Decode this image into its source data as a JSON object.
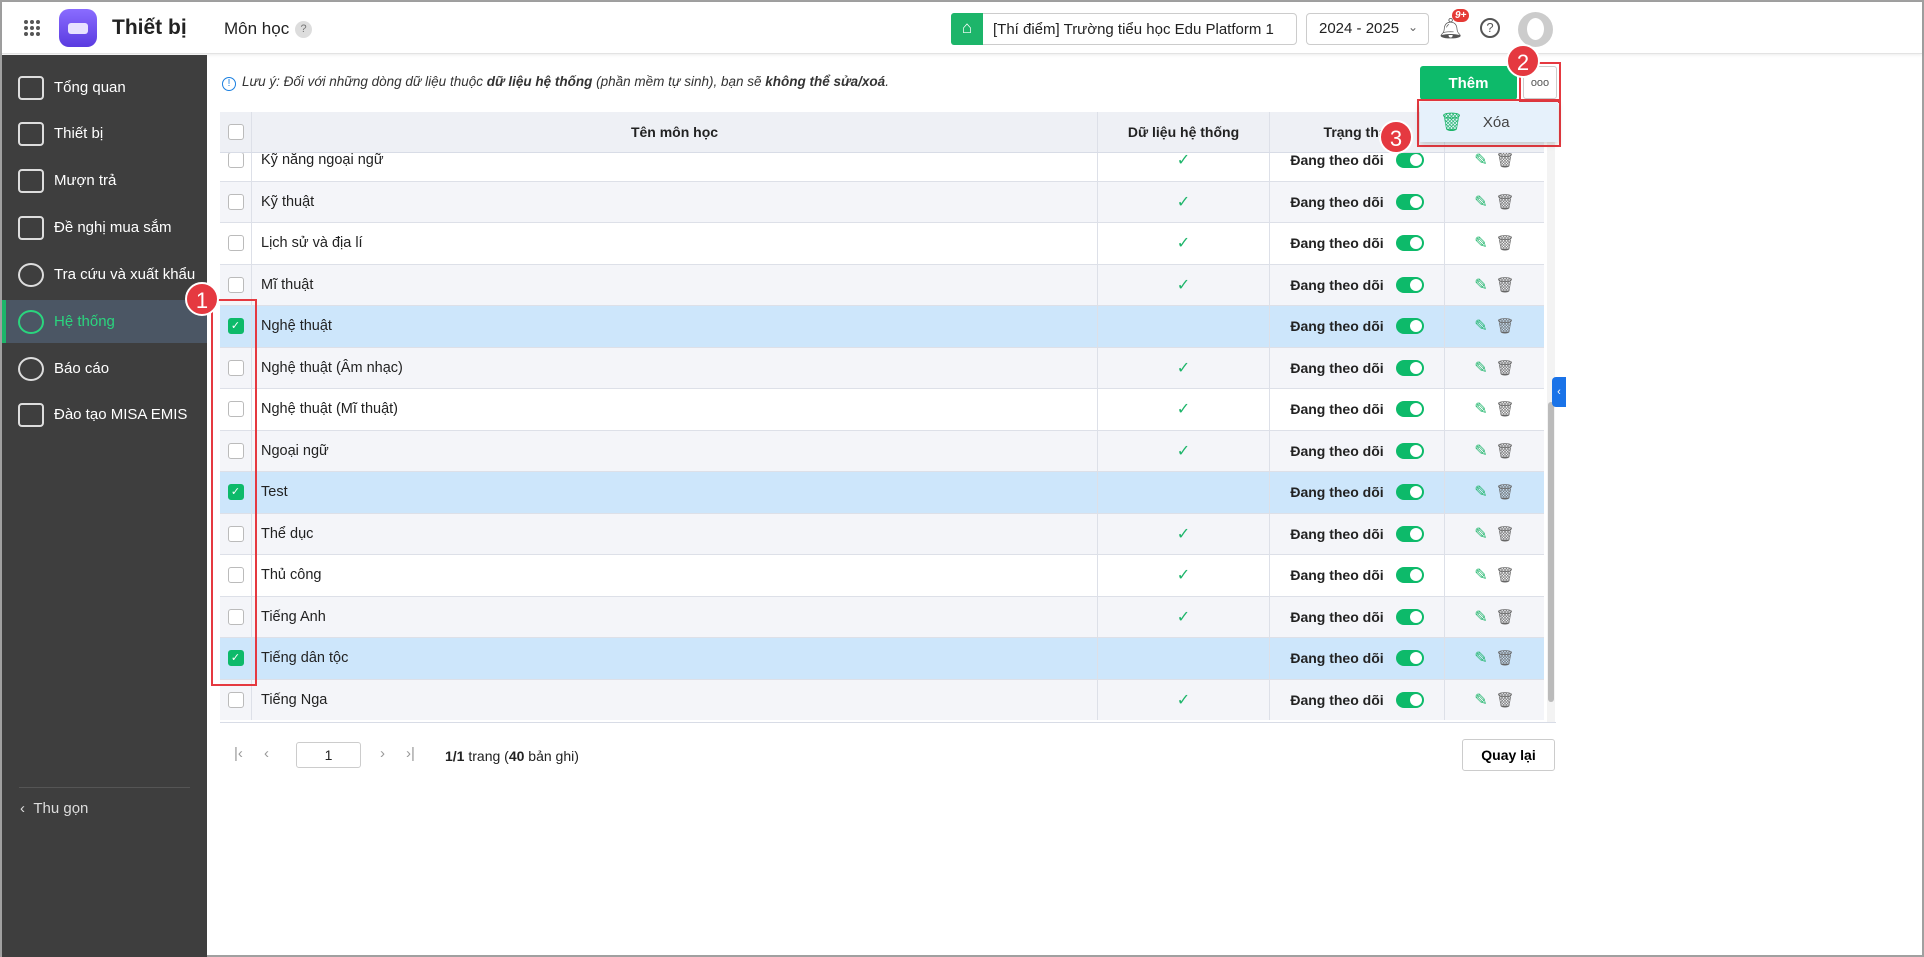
{
  "header": {
    "app_title": "Thiết bị",
    "page_title": "Môn học",
    "help_mark": "?",
    "school": "[Thí điểm] Trường tiểu học Edu Platform 1",
    "year": "2024 - 2025",
    "notif_badge": "9+",
    "help_icon": "?"
  },
  "sidebar": {
    "items": [
      {
        "label": "Tổng quan"
      },
      {
        "label": "Thiết bị"
      },
      {
        "label": "Mượn trả"
      },
      {
        "label": "Đề nghị mua sắm"
      },
      {
        "label": "Tra cứu và xuất khẩu"
      },
      {
        "label": "Hệ thống"
      },
      {
        "label": "Báo cáo"
      },
      {
        "label": "Đào tạo MISA EMIS"
      }
    ],
    "collapse": "Thu gọn"
  },
  "note": {
    "prefix": "Lưu ý: Đối với những dòng dữ liệu thuộc ",
    "bold1": "dữ liệu hệ thống",
    "mid": " (phần mềm tự sinh), bạn sẽ ",
    "bold2": "không thể sửa/xoá",
    "end": "."
  },
  "toolbar": {
    "add": "Thêm",
    "more": "ooo",
    "menu_delete": "Xóa"
  },
  "annotations": [
    "1",
    "2",
    "3"
  ],
  "table": {
    "headers": [
      "Tên môn học",
      "Dữ liệu hệ thống",
      "Trạng thái"
    ],
    "rows": [
      {
        "name": "Kỹ năng ngoại ngữ",
        "system": true,
        "checked": false,
        "status": "Đang theo dõi"
      },
      {
        "name": "Kỹ thuật",
        "system": true,
        "checked": false,
        "status": "Đang theo dõi"
      },
      {
        "name": "Lịch sử và địa lí",
        "system": true,
        "checked": false,
        "status": "Đang theo dõi"
      },
      {
        "name": "Mĩ thuật",
        "system": true,
        "checked": false,
        "status": "Đang theo dõi"
      },
      {
        "name": "Nghệ thuật",
        "system": false,
        "checked": true,
        "status": "Đang theo dõi"
      },
      {
        "name": "Nghệ thuật (Âm nhạc)",
        "system": true,
        "checked": false,
        "status": "Đang theo dõi"
      },
      {
        "name": "Nghệ thuật (Mĩ thuật)",
        "system": true,
        "checked": false,
        "status": "Đang theo dõi"
      },
      {
        "name": "Ngoại ngữ",
        "system": true,
        "checked": false,
        "status": "Đang theo dõi"
      },
      {
        "name": "Test",
        "system": false,
        "checked": true,
        "status": "Đang theo dõi"
      },
      {
        "name": "Thể dục",
        "system": true,
        "checked": false,
        "status": "Đang theo dõi"
      },
      {
        "name": "Thủ công",
        "system": true,
        "checked": false,
        "status": "Đang theo dõi"
      },
      {
        "name": "Tiếng Anh",
        "system": true,
        "checked": false,
        "status": "Đang theo dõi"
      },
      {
        "name": "Tiếng dân tộc",
        "system": false,
        "checked": true,
        "status": "Đang theo dõi"
      },
      {
        "name": "Tiếng Nga",
        "system": true,
        "checked": false,
        "status": "Đang theo dõi"
      }
    ]
  },
  "pagination": {
    "page": "1",
    "page_info": "1/1",
    "page_word": " trang (",
    "total": "40",
    "total_suffix": " bản ghi)"
  },
  "footer": {
    "back": "Quay lại"
  }
}
